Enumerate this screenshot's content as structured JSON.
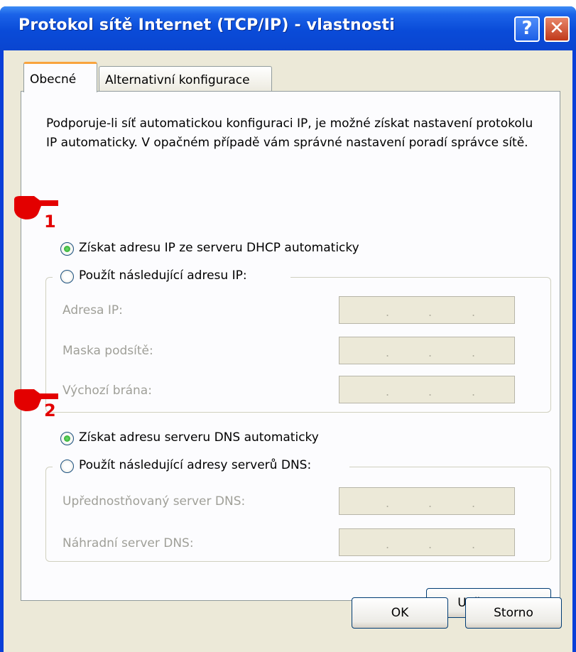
{
  "window": {
    "title": "Protokol sítě Internet (TCP/IP) - vlastnosti",
    "help_label": "?",
    "close_label": "✕"
  },
  "tabs": [
    {
      "label": "Obecné",
      "active": true
    },
    {
      "label": "Alternativní konfigurace",
      "active": false
    }
  ],
  "intro": "Podporuje-li síť automatickou konfiguraci IP, je možné získat nastavení protokolu IP automaticky. V opačném případě vám správné nastavení poradí správce sítě.",
  "ip": {
    "auto_label": "Získat adresu IP ze serveru DHCP automaticky",
    "manual_label": "Použít následující adresu IP:",
    "selected": "auto",
    "fields": [
      {
        "label": "Adresa IP:",
        "value": ". . ."
      },
      {
        "label": "Maska podsítě:",
        "value": ". . ."
      },
      {
        "label": "Výchozí brána:",
        "value": ". . ."
      }
    ]
  },
  "dns": {
    "auto_label": "Získat adresu serveru DNS automaticky",
    "manual_label": "Použít následující adresy serverů DNS:",
    "selected": "auto",
    "fields": [
      {
        "label": "Upřednostňovaný server DNS:",
        "value": ". . ."
      },
      {
        "label": "Náhradní server DNS:",
        "value": ". . ."
      }
    ]
  },
  "buttons": {
    "advanced": "Upřesnit...",
    "ok": "OK",
    "cancel": "Storno"
  },
  "annotations": {
    "marker1": "1",
    "marker2": "2"
  },
  "colors": {
    "titlebar": "#0a4bd8",
    "dialog_bg": "#ece9d8",
    "annotation": "#e30000",
    "tab_highlight": "#f9a43d"
  }
}
